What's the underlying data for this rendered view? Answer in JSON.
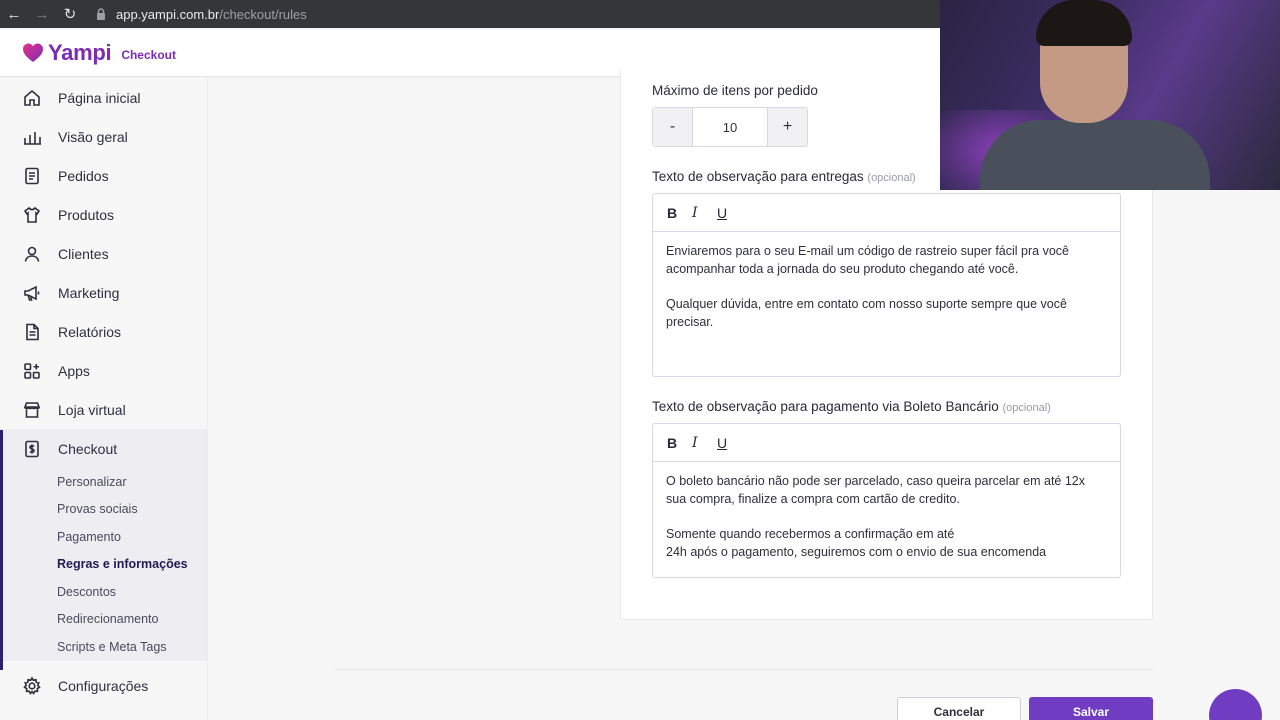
{
  "browser": {
    "url_host": "app.yampi.com.br",
    "url_path": "/checkout/rules"
  },
  "header": {
    "brand": "Yampi",
    "section": "Checkout"
  },
  "sidebar": {
    "items": [
      {
        "label": "Página inicial",
        "icon": "home-icon"
      },
      {
        "label": "Visão geral",
        "icon": "chart-icon"
      },
      {
        "label": "Pedidos",
        "icon": "list-icon"
      },
      {
        "label": "Produtos",
        "icon": "shirt-icon"
      },
      {
        "label": "Clientes",
        "icon": "user-icon"
      },
      {
        "label": "Marketing",
        "icon": "megaphone-icon"
      },
      {
        "label": "Relatórios",
        "icon": "report-icon"
      },
      {
        "label": "Apps",
        "icon": "apps-icon"
      },
      {
        "label": "Loja virtual",
        "icon": "store-icon"
      },
      {
        "label": "Checkout",
        "icon": "checkout-icon"
      }
    ],
    "checkout_sub": [
      "Personalizar",
      "Provas sociais",
      "Pagamento",
      "Regras e informações",
      "Descontos",
      "Redirecionamento",
      "Scripts e Meta Tags"
    ],
    "settings_label": "Configurações"
  },
  "form": {
    "max_items_label": "Máximo de itens por pedido",
    "stepper_minus": "-",
    "stepper_plus": "+",
    "max_items_value": "10",
    "delivery_label": "Texto de observação para entregas",
    "optional_tag": "(opcional)",
    "delivery_text": {
      "line1": "Enviaremos para o seu E-mail um código de rastreio super fácil pra você",
      "line2": "acompanhar toda a jornada do seu produto chegando até você.",
      "line3": "Qualquer dúvida, entre em contato com nosso suporte sempre que você",
      "line4": "precisar."
    },
    "boleto_label": "Texto de observação para pagamento via Boleto Bancário",
    "boleto_text": {
      "line1": "O boleto bancário não pode ser parcelado, caso queira parcelar em até 12x",
      "line2": "sua compra, finalize a compra com cartão de credito.",
      "line3": "Somente quando recebermos a confirmação em até",
      "line4": "24h após o pagamento, seguiremos com o envio de sua encomenda"
    },
    "toolbar": {
      "bold": "B",
      "italic": "I",
      "underline": "U"
    }
  },
  "actions": {
    "cancel": "Cancelar",
    "save": "Salvar"
  },
  "colors": {
    "brand": "#7a2db3",
    "primary_button": "#6f3cc2"
  }
}
